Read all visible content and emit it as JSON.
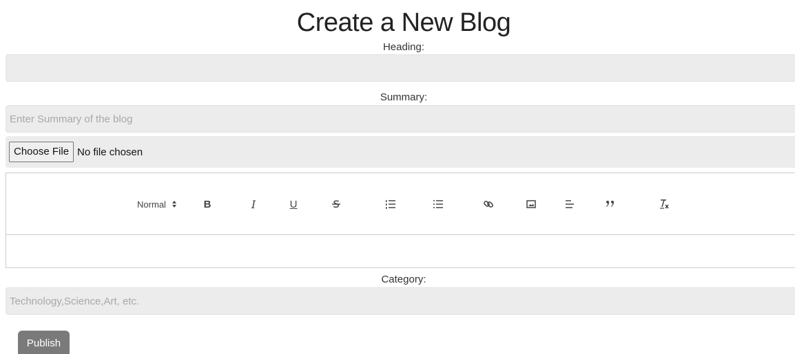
{
  "page": {
    "title": "Create a New Blog"
  },
  "form": {
    "heading_label": "Heading:",
    "heading_value": "",
    "summary_label": "Summary:",
    "summary_placeholder": "Enter Summary of the blog",
    "file": {
      "button_label": "Choose File",
      "status": "No file chosen"
    },
    "editor": {
      "header_select": "Normal",
      "toolbar_icons": [
        "bold-icon",
        "italic-icon",
        "underline-icon",
        "strike-icon",
        "ordered-list-icon",
        "bullet-list-icon",
        "link-icon",
        "image-icon",
        "align-icon",
        "blockquote-icon",
        "clean-format-icon"
      ],
      "toolbar_glyphs": {
        "bold": "B",
        "italic": "I",
        "underline": "U"
      }
    },
    "category_label": "Category:",
    "category_placeholder": "Technology,Science,Art, etc.",
    "publish_label": "Publish"
  },
  "colors": {
    "field_bg": "#ececec",
    "publish_bg": "#7a7a7a",
    "text": "#222222"
  }
}
